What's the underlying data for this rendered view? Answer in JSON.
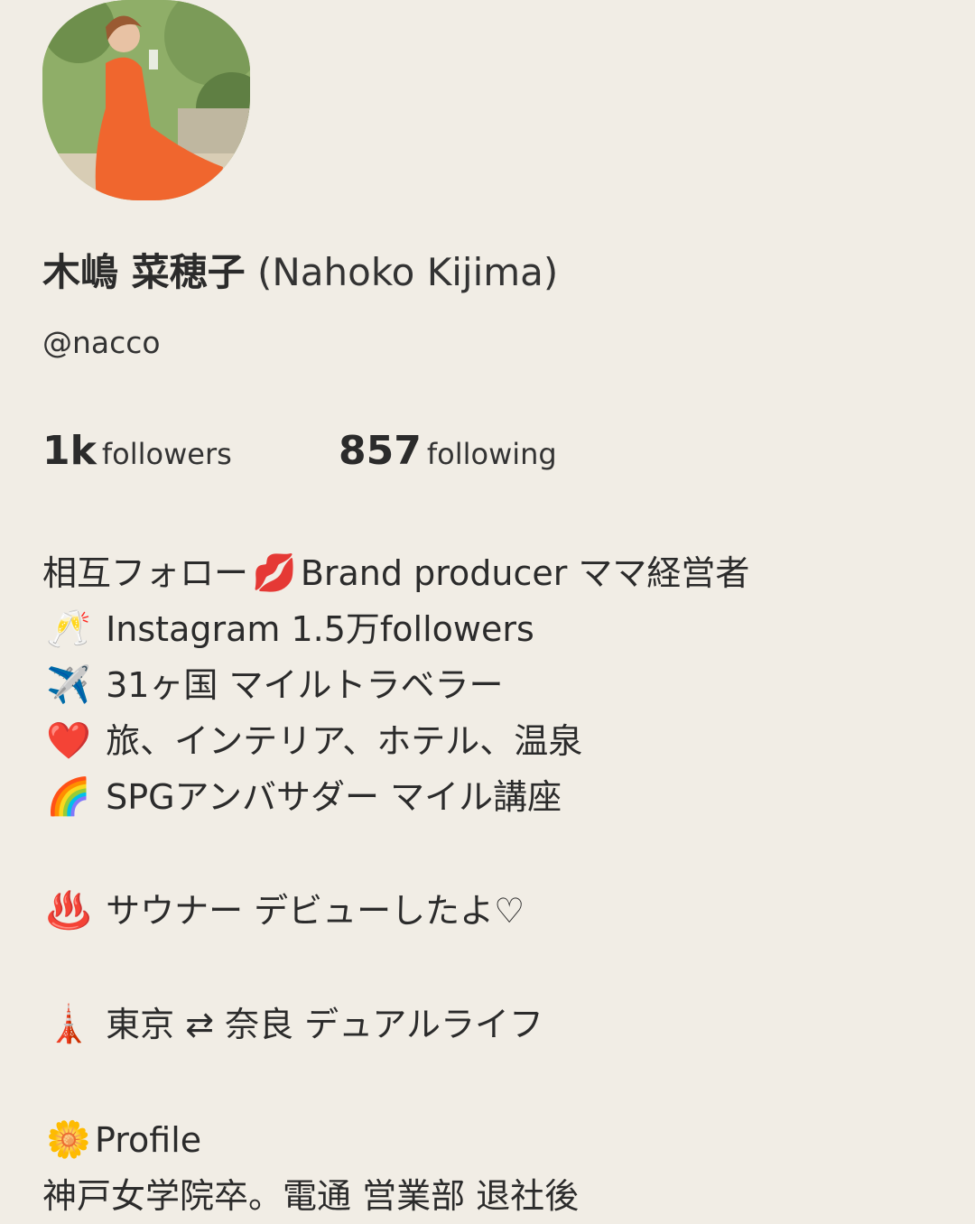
{
  "profile": {
    "name_jp": "木嶋 菜穂子",
    "name_en": "(Nahoko Kijima)",
    "handle": "@nacco",
    "followers_count": "1k",
    "followers_label": "followers",
    "following_count": "857",
    "following_label": "following"
  },
  "bio": {
    "line1_a": "相互フォロー",
    "line1_emoji": "💋",
    "line1_b": "Brand producer ママ経営者",
    "line2_emoji": "🥂",
    "line2_text": " Instagram 1.5万followers",
    "line3_emoji": "✈️",
    "line3_text": " 31ヶ国 マイルトラベラー",
    "line4_emoji": "❤️",
    "line4_text": " 旅、インテリア、ホテル、温泉",
    "line5_emoji": "🌈",
    "line5_text": " SPGアンバサダー マイル講座",
    "line6_emoji": "♨️",
    "line6_text": " サウナー デビューしたよ♡",
    "line7_emoji": "🗼",
    "line7_text": " 東京 ⇄ 奈良 デュアルライフ",
    "line8_emoji": "🌼",
    "line8_text": "Profile",
    "line9_text": "神戸女学院卒。電通 営業部 退社後"
  },
  "colors": {
    "background": "#f1ede5",
    "text": "#2b2b2b",
    "dress": "#f0662e"
  }
}
